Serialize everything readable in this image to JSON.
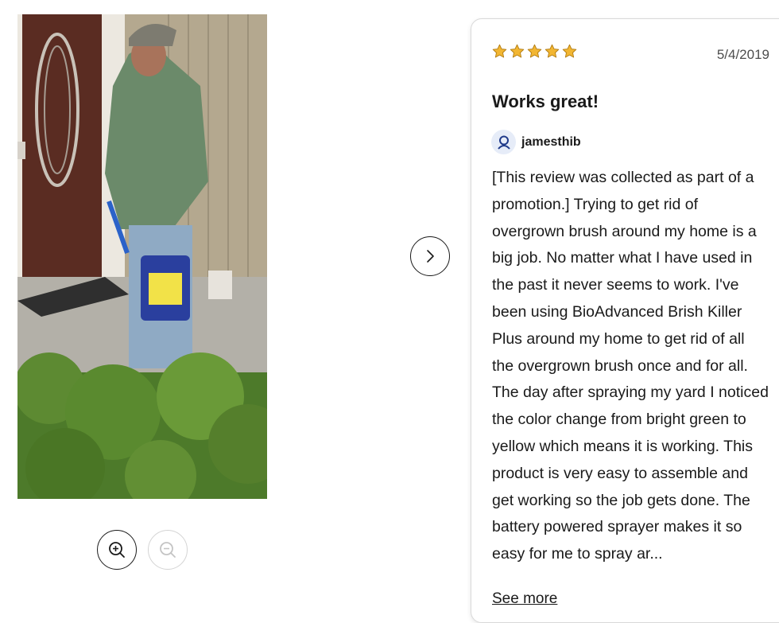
{
  "gallery": {
    "photo_alt": "",
    "zoom_in_icon": "zoom-in-icon",
    "zoom_out_icon": "zoom-out-icon",
    "next_icon": "chevron-right-icon"
  },
  "review": {
    "rating": 5,
    "rating_max": 5,
    "star_color": "#f2b632",
    "date": "5/4/2019",
    "title": "Works great!",
    "author": "jamesthib",
    "author_icon": "user-icon",
    "body": "[This review was collected as part of a promotion.] Trying to get rid of overgrown brush around my home is a big job. No matter what I have used in the past it never seems to work. I've been using BioAdvanced Brish Killer Plus around my home to get rid of all the overgrown brush once and for all. The day after spraying my yard I noticed the color change from bright green to yellow which means it is working. This product is very easy to assemble and get working so the job gets done. The battery powered sprayer makes it so easy for me to spray ar...",
    "see_more": "See more"
  }
}
